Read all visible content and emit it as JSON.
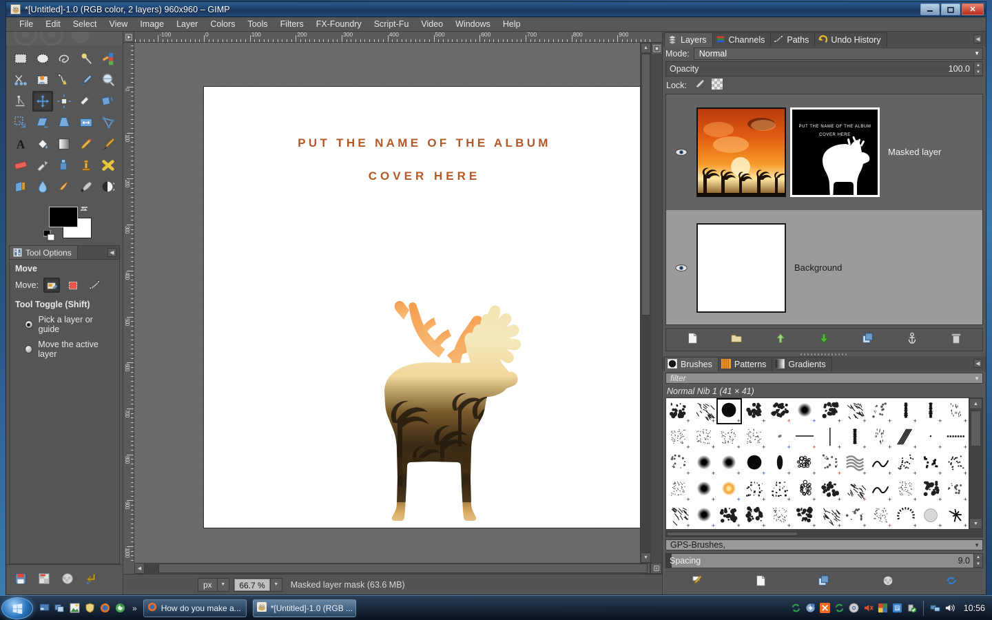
{
  "window": {
    "title": "*[Untitled]-1.0 (RGB color, 2 layers) 960x960 – GIMP",
    "minimize_label": "—",
    "maximize_label": "❐",
    "close_label": "✕",
    "app_icon": "gimp-wilber-icon"
  },
  "menubar": {
    "items": [
      {
        "label": "File"
      },
      {
        "label": "Edit"
      },
      {
        "label": "Select"
      },
      {
        "label": "View"
      },
      {
        "label": "Image"
      },
      {
        "label": "Layer"
      },
      {
        "label": "Colors"
      },
      {
        "label": "Tools"
      },
      {
        "label": "Filters"
      },
      {
        "label": "FX-Foundry"
      },
      {
        "label": "Script-Fu"
      },
      {
        "label": "Video"
      },
      {
        "label": "Windows"
      },
      {
        "label": "Help"
      }
    ]
  },
  "toolbox": {
    "tools": [
      {
        "name": "rect-select-tool"
      },
      {
        "name": "ellipse-select-tool"
      },
      {
        "name": "free-select-tool"
      },
      {
        "name": "fuzzy-select-tool"
      },
      {
        "name": "select-by-color-tool"
      },
      {
        "name": "scissors-select-tool"
      },
      {
        "name": "foreground-select-tool"
      },
      {
        "name": "paths-tool"
      },
      {
        "name": "color-picker-tool"
      },
      {
        "name": "zoom-tool"
      },
      {
        "name": "measure-tool"
      },
      {
        "name": "move-tool"
      },
      {
        "name": "alignment-tool"
      },
      {
        "name": "crop-tool"
      },
      {
        "name": "rotate-tool"
      },
      {
        "name": "scale-tool"
      },
      {
        "name": "shear-tool"
      },
      {
        "name": "perspective-tool"
      },
      {
        "name": "flip-tool"
      },
      {
        "name": "cage-transform-tool"
      },
      {
        "name": "text-tool"
      },
      {
        "name": "bucket-fill-tool"
      },
      {
        "name": "blend-gradient-tool"
      },
      {
        "name": "pencil-tool"
      },
      {
        "name": "paintbrush-tool"
      },
      {
        "name": "eraser-tool"
      },
      {
        "name": "airbrush-tool"
      },
      {
        "name": "ink-tool"
      },
      {
        "name": "clone-tool"
      },
      {
        "name": "heal-tool"
      },
      {
        "name": "perspective-clone-tool"
      },
      {
        "name": "blur-sharpen-tool"
      },
      {
        "name": "smudge-tool"
      },
      {
        "name": "dodge-burn-tool"
      },
      {
        "name": "brightness-contrast-tool"
      }
    ],
    "active_tool": "move-tool",
    "foreground_color": "#000000",
    "background_color": "#ffffff",
    "footer_icons": [
      {
        "name": "save-icon"
      },
      {
        "name": "restore-icon"
      },
      {
        "name": "transparency-icon"
      },
      {
        "name": "reset-icon"
      }
    ]
  },
  "tool_options": {
    "tab_label": "Tool Options",
    "tool_title": "Move",
    "move_label": "Move:",
    "move_modes": [
      {
        "name": "move-layer-mode",
        "selected": true
      },
      {
        "name": "move-selection-mode",
        "selected": false
      },
      {
        "name": "move-path-mode",
        "selected": false
      }
    ],
    "toggle_title": "Tool Toggle  (Shift)",
    "radios": [
      {
        "label": "Pick a layer or guide",
        "selected": true
      },
      {
        "label": "Move the active layer",
        "selected": false
      }
    ]
  },
  "canvas": {
    "horizontal_ruler_labels": [
      "-100",
      "0",
      "100",
      "200",
      "300",
      "400",
      "500",
      "600",
      "700",
      "800",
      "900"
    ],
    "vertical_ruler_labels": [
      "0",
      "0",
      "0",
      "1",
      "1",
      "2",
      "2",
      "3",
      "3",
      "4",
      "4",
      "5",
      "5",
      "6",
      "6",
      "7",
      "7",
      "8",
      "8",
      "9"
    ],
    "album_title_line1": "PUT THE NAME OF THE ALBUM",
    "album_title_line2": "COVER HERE",
    "album_title_color": "#b35826",
    "artwork": "deer-silhouette-double-exposure"
  },
  "statusbar": {
    "unit": "px",
    "zoom": "66.7 %",
    "status_text": "Masked layer mask (63.6 MB)"
  },
  "layers_dock": {
    "tabs": [
      {
        "label": "Layers",
        "icon": "layers-icon",
        "active": true
      },
      {
        "label": "Channels",
        "icon": "channels-icon",
        "active": false
      },
      {
        "label": "Paths",
        "icon": "paths-icon",
        "active": false
      },
      {
        "label": "Undo History",
        "icon": "undo-history-icon",
        "active": false
      }
    ],
    "mode_label": "Mode:",
    "mode_value": "Normal",
    "opacity_label": "Opacity",
    "opacity_value": "100.0",
    "lock_label": "Lock:",
    "lock_items": [
      {
        "name": "lock-pixels-icon"
      },
      {
        "name": "lock-alpha-icon"
      }
    ],
    "layers": [
      {
        "name": "Masked layer",
        "visible": true,
        "selected": true,
        "has_mask": true
      },
      {
        "name": "Background",
        "visible": true,
        "selected": false,
        "has_mask": false
      }
    ],
    "buttons": [
      {
        "name": "new-layer-button"
      },
      {
        "name": "new-layer-group-button"
      },
      {
        "name": "raise-layer-button"
      },
      {
        "name": "lower-layer-button"
      },
      {
        "name": "duplicate-layer-button"
      },
      {
        "name": "anchor-layer-button"
      },
      {
        "name": "delete-layer-button"
      }
    ]
  },
  "brushes_dock": {
    "tabs": [
      {
        "label": "Brushes",
        "icon": "brushes-icon",
        "active": true
      },
      {
        "label": "Patterns",
        "icon": "patterns-icon",
        "active": false
      },
      {
        "label": "Gradients",
        "icon": "gradients-icon",
        "active": false
      }
    ],
    "filter_placeholder": "filter",
    "selected_brush": "Normal Nib 1 (41 × 41)",
    "tag_value": "GPS-Brushes,",
    "spacing_label": "Spacing",
    "spacing_value": "9.0",
    "buttons": [
      {
        "name": "edit-brush-button"
      },
      {
        "name": "new-brush-button"
      },
      {
        "name": "duplicate-brush-button"
      },
      {
        "name": "delete-brush-button"
      },
      {
        "name": "refresh-brushes-button"
      }
    ]
  },
  "taskbar": {
    "start_label": "Start",
    "quick_launch": [
      {
        "name": "show-desktop-icon"
      },
      {
        "name": "switch-window-icon"
      },
      {
        "name": "image-viewer-icon"
      },
      {
        "name": "shield-icon"
      },
      {
        "name": "firefox-icon"
      },
      {
        "name": "browser-icon"
      }
    ],
    "overflow_label": "»",
    "tasks": [
      {
        "label": "How do you make a...",
        "icon": "firefox-icon",
        "active": false
      },
      {
        "label": "*[Untitled]-1.0 (RGB ...",
        "icon": "gimp-icon",
        "active": true
      }
    ],
    "tray_icons": [
      {
        "name": "sync-icon"
      },
      {
        "name": "update-icon"
      },
      {
        "name": "xampp-icon"
      },
      {
        "name": "sync2-icon"
      },
      {
        "name": "disc-icon"
      },
      {
        "name": "speaker-mute-icon"
      },
      {
        "name": "color-app-icon"
      },
      {
        "name": "blue-app-icon"
      },
      {
        "name": "usb-safe-icon"
      },
      {
        "name": "network-icon"
      },
      {
        "name": "volume-icon"
      }
    ],
    "clock": "10:56"
  }
}
